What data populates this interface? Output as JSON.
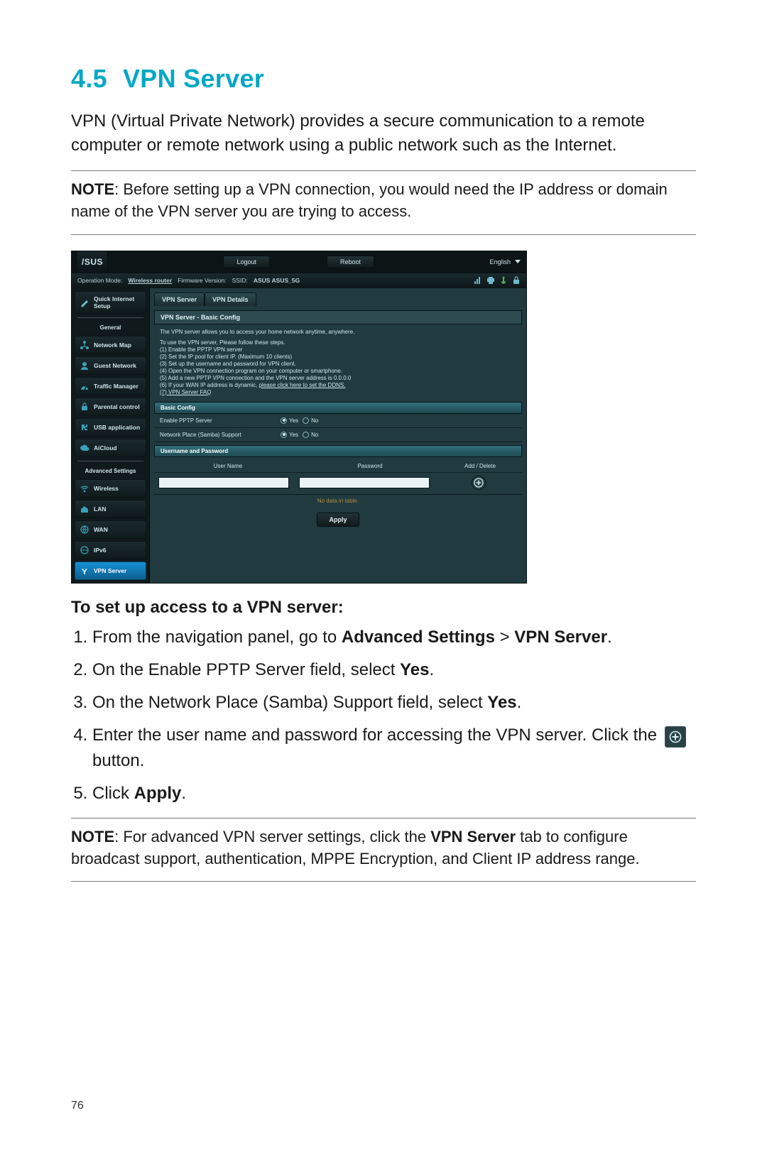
{
  "doc": {
    "section_number": "4.5",
    "section_title": "VPN Server",
    "intro_paragraph": "VPN (Virtual Private Network) provides a secure communication to a remote computer or remote network using a public network such as the Internet.",
    "note1_label": "NOTE",
    "note1_text": ":  Before setting up a VPN connection, you would need the IP address or domain name of the VPN server you are trying to access.",
    "instructions_heading": "To set up access to a VPN server:",
    "step1_pre": "From the navigation panel, go to ",
    "step1_b1": "Advanced Settings",
    "step1_mid": " > ",
    "step1_b2": "VPN Server",
    "step1_post": ".",
    "step2_pre": "On the Enable PPTP Server field, select ",
    "step2_b": "Yes",
    "step2_post": ".",
    "step3_pre": "On the Network Place (Samba) Support field, select ",
    "step3_b": "Yes",
    "step3_post": ".",
    "step4_pre": "Enter the user name and password for accessing the VPN server. Click the ",
    "step4_post": " button.",
    "step5_pre": "Click ",
    "step5_b": "Apply",
    "step5_post": ".",
    "note2_label": "NOTE",
    "note2_text_pre": ":  For advanced VPN server settings, click the ",
    "note2_b": "VPN Server",
    "note2_text_post": " tab to configure broadcast support, authentication, MPPE Encryption, and Client IP address range.",
    "page_number": "76"
  },
  "shot": {
    "brand": "/SUS",
    "logout": "Logout",
    "reboot": "Reboot",
    "language": "English",
    "status_mode_label": "Operation Mode:",
    "status_mode_value": "Wireless router",
    "status_fw_label": "Firmware Version:",
    "status_ssid_label": "SSID:",
    "status_ssid_value": "ASUS  ASUS_5G",
    "sidebar": {
      "qis": "Quick Internet Setup",
      "general_header": "General",
      "items_general": [
        "Network Map",
        "Guest Network",
        "Traffic Manager",
        "Parental control",
        "USB application",
        "AiCloud"
      ],
      "advanced_header": "Advanced Settings",
      "items_adv": [
        "Wireless",
        "LAN",
        "WAN",
        "IPv6",
        "VPN Server"
      ]
    },
    "tabs": {
      "server": "VPN Server",
      "details": "VPN Details"
    },
    "card_title": "VPN Server - Basic Config",
    "intro": "The VPN server allows you to access your home network anytime, anywhere.",
    "steps_lead": "To use the VPN server, Please follow these steps.",
    "steps": [
      "(1) Enable the PPTP VPN server",
      "(2) Set the IP pool for client IP. (Maximum 10 clients)",
      "(3) Set up the username and password for VPN client.",
      "(4) Open the VPN connection program on your computer or smartphone.",
      "(5) Add a new PPTP VPN connection and the VPN server address is 0.0.0.0"
    ],
    "step6_pre": "(6) If your WAN IP address is dynamic, ",
    "step6_link": "please click here to set the DDNS.",
    "step7_link": "(7) VPN Server FAQ",
    "pill_basic": "Basic Config",
    "row_enable": "Enable PPTP Server",
    "row_samba": "Network Place (Samba) Support",
    "opt_yes": "Yes",
    "opt_no": "No",
    "pill_userpw": "Username and Password",
    "col_user": "User Name",
    "col_pass": "Password",
    "col_add": "Add / Delete",
    "empty": "No data in table.",
    "apply": "Apply"
  }
}
